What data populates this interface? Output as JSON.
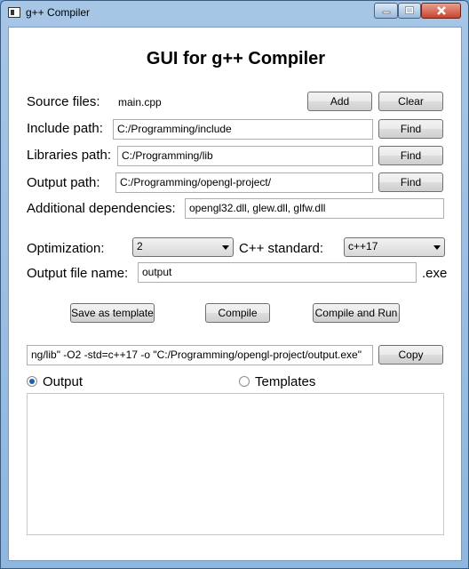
{
  "window": {
    "title": "g++ Compiler"
  },
  "heading": "GUI for g++ Compiler",
  "source": {
    "label": "Source files:",
    "value": "main.cpp",
    "add_label": "Add",
    "clear_label": "Clear"
  },
  "include": {
    "label": "Include path:",
    "value": "C:/Programming/include",
    "find_label": "Find"
  },
  "libraries": {
    "label": "Libraries path:",
    "value": "C:/Programming/lib",
    "find_label": "Find"
  },
  "output_path": {
    "label": "Output path:",
    "value": "C:/Programming/opengl-project/",
    "find_label": "Find"
  },
  "dependencies": {
    "label": "Additional dependencies:",
    "value": "opengl32.dll, glew.dll, glfw.dll"
  },
  "optimization": {
    "label": "Optimization:",
    "value": "2"
  },
  "standard": {
    "label": "C++ standard:",
    "value": "c++17"
  },
  "output_name": {
    "label": "Output file name:",
    "value": "output",
    "ext": ".exe"
  },
  "actions": {
    "template_label": "Save as template",
    "compile_label": "Compile",
    "compile_run_label": "Compile and Run"
  },
  "command": {
    "value": "ng/lib\" -O2 -std=c++17 -o \"C:/Programming/opengl-project/output.exe\"",
    "copy_label": "Copy"
  },
  "tabs": {
    "output_label": "Output",
    "templates_label": "Templates",
    "selected": "output"
  },
  "output_box": {
    "text": ""
  }
}
